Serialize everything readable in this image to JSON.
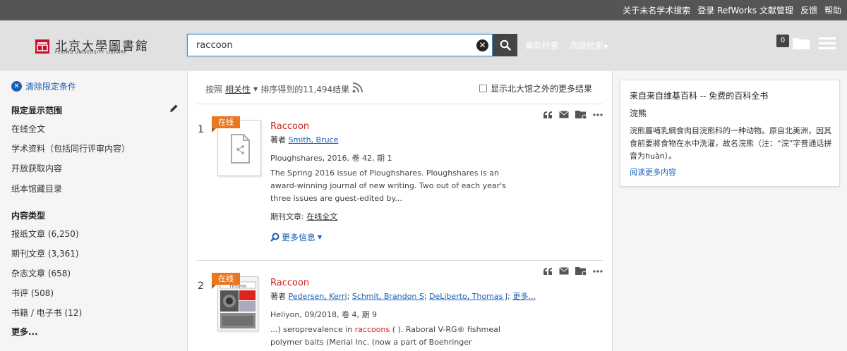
{
  "topbar": {
    "links": [
      "关于未名学术搜索",
      "登录 RefWorks 文献管理",
      "反馈",
      "帮助"
    ]
  },
  "header": {
    "logo_text": "北京大學圖書館",
    "logo_subtext": "PEKING UNIVERSITY LIBRARY",
    "search_value": "raccoon",
    "new_search": "重新检索",
    "advanced_search": "高级检索",
    "basket_count": "0"
  },
  "sidebar": {
    "clear_limits": "清除限定条件",
    "limit_title": "限定显示范围",
    "limit_items": [
      "在线全文",
      "学术资料（包括同行评审内容）",
      "开放获取内容",
      "纸本馆藏目录"
    ],
    "content_type_title": "内容类型",
    "content_types": [
      "报纸文章 (6,250)",
      "期刊文章 (3,361)",
      "杂志文章 (658)",
      "书评 (508)",
      "书籍 / 电子书 (12)"
    ],
    "more": "更多..."
  },
  "main": {
    "sort_prefix": "按照",
    "sort_by": "相关性",
    "sort_suffix": "排序得到的11,494结果",
    "beyond_label": "显示北大馆之外的更多结果",
    "results": [
      {
        "num": "1",
        "tag": "在线",
        "title": "Raccoon",
        "authors_prefix": "著者",
        "authors": [
          "Smith, Bruce"
        ],
        "source": "Ploughshares, 2016, 卷 42, 期 1",
        "abstract": "The Spring 2016 issue of Ploughshares. Ploughshares is an award-winning journal of new writing. Two out of each year's three issues are guest-edited by...",
        "type_prefix": "期刊文章:",
        "type_link": "在线全文",
        "more_info": "更多信息"
      },
      {
        "num": "2",
        "tag": "在线",
        "title": "Raccoon",
        "authors_prefix": "著者",
        "authors": [
          "Pedersen, Kerri",
          "Schmit, Brandon S",
          "DeLiberto, Thomas J",
          "更多..."
        ],
        "source": "Heliyon, 09/2018, 卷 4, 期 9",
        "abstract_pre": "...) seroprevalence in ",
        "abstract_hl": "raccoons",
        "abstract_post": " ( ). Raboral V-RG® fishmeal polymer baits (Merial Inc. (now a part of Boehringer Ingelheim),",
        "thumb_label": "Heliyon"
      }
    ]
  },
  "wiki": {
    "title": "来自来自维基百科 -- 免费的百科全书",
    "term": "浣熊",
    "text": "浣熊屬哺乳綱食肉目浣熊科的一种动物。原自北美洲，因其食前要將食物在水中洗濯，故名浣熊（注：“浣”字普通话拼音为huàn）。",
    "more": "阅读更多内容"
  },
  "colors": {
    "accent": "#1a5fb4",
    "title_red": "#d02020",
    "online_tag": "#e87722",
    "header_bg": "#e1e1e1",
    "topbar_bg": "#555555"
  }
}
